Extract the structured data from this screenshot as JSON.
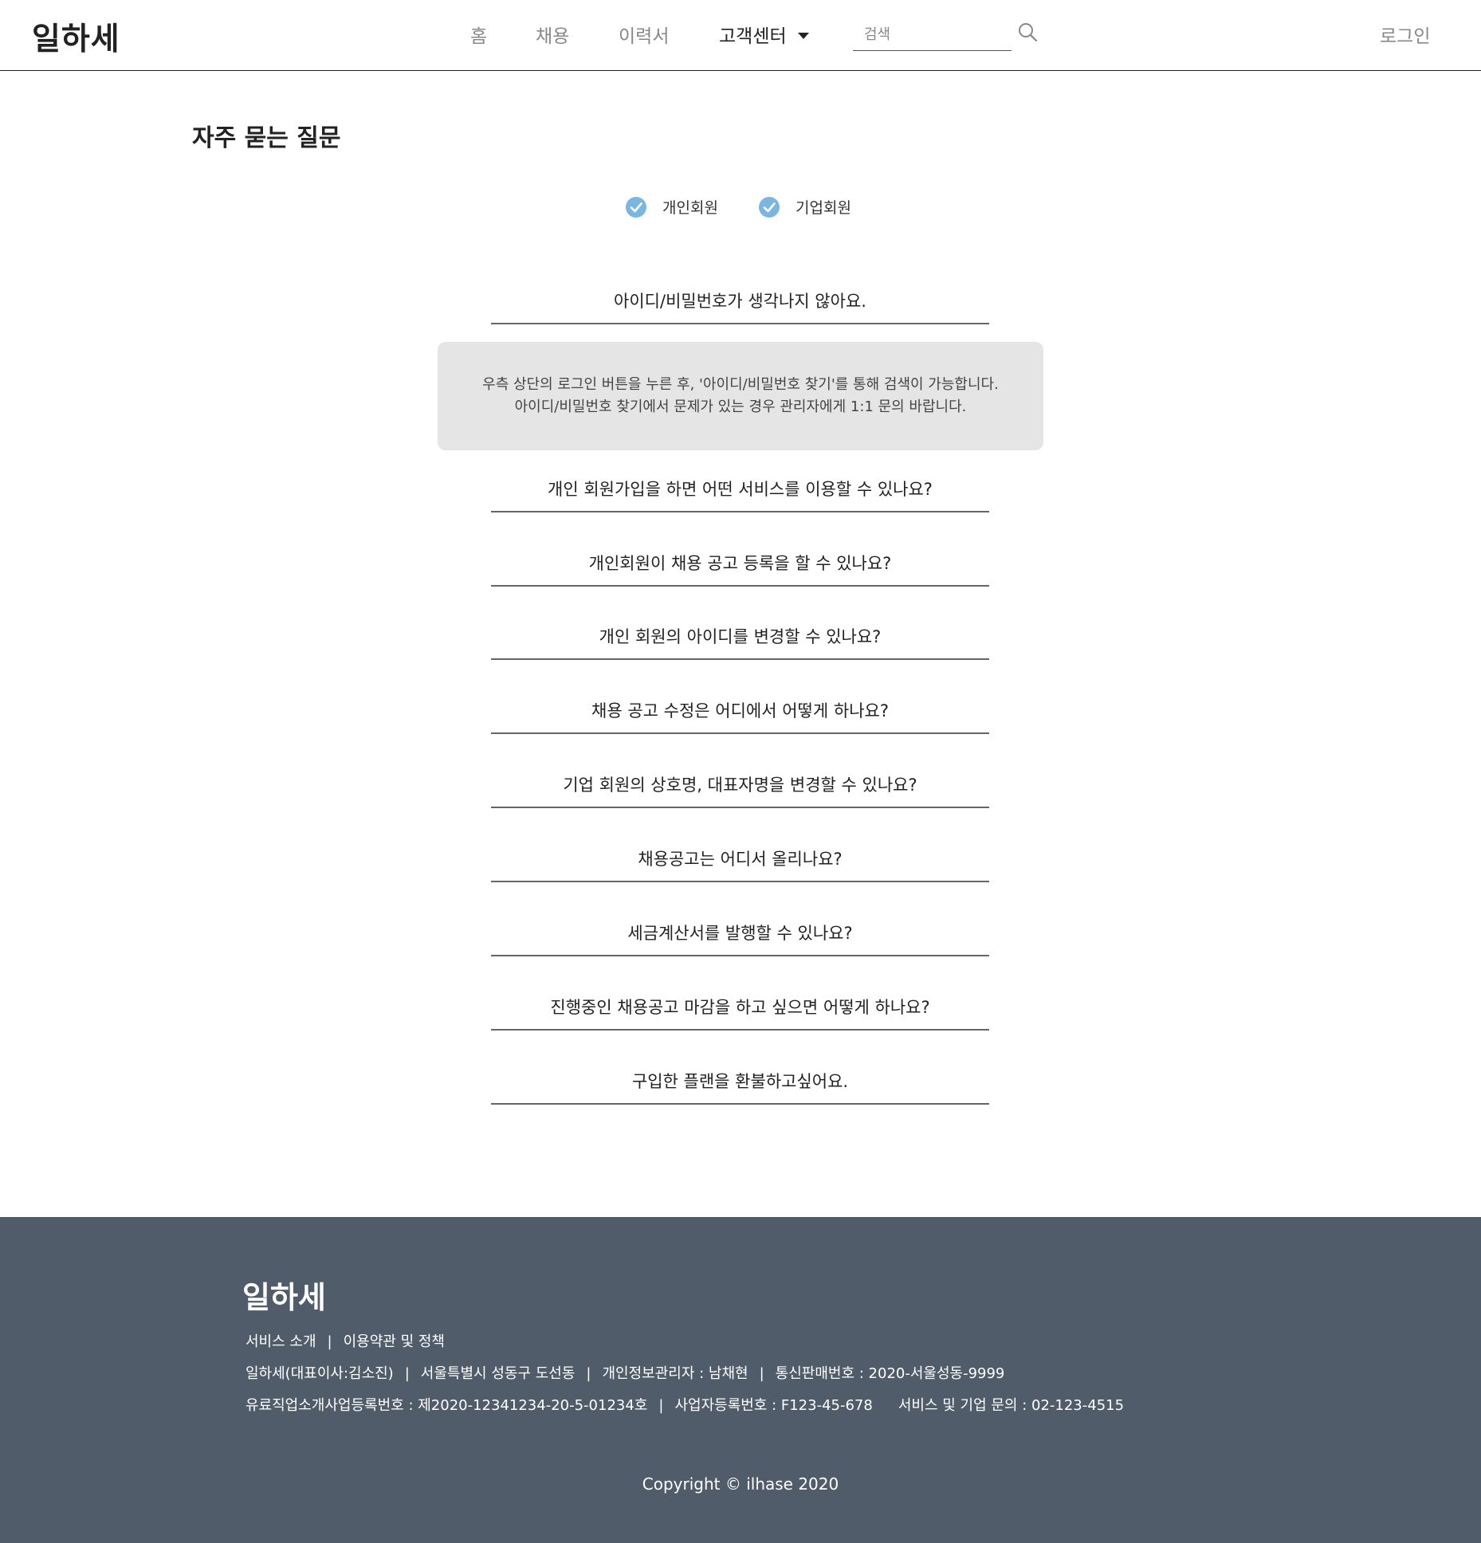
{
  "header": {
    "logo": "일하세",
    "nav": {
      "home": "홈",
      "jobs": "채용",
      "resume": "이력서",
      "support": "고객센터"
    },
    "search_placeholder": "검색",
    "login": "로그인"
  },
  "main": {
    "title": "자주 묻는 질문",
    "filters": [
      {
        "label": "개인회원",
        "checked": true
      },
      {
        "label": "기업회원",
        "checked": true
      }
    ],
    "accent_color": "#7ab6e0",
    "faq": [
      "아이디/비밀번호가 생각나지 않아요.",
      "개인 회원가입을 하면 어떤 서비스를 이용할 수 있나요?",
      "개인회원이 채용 공고 등록을 할 수 있나요?",
      "개인 회원의 아이디를 변경할 수 있나요?",
      "채용 공고 수정은 어디에서 어떻게 하나요?",
      "기업 회원의 상호명, 대표자명을 변경할 수 있나요?",
      "채용공고는 어디서 올리나요?",
      "세금계산서를 발행할 수 있나요?",
      "진행중인 채용공고 마감을 하고 싶으면 어떻게 하나요?",
      "구입한 플랜을 환불하고싶어요."
    ],
    "answer": {
      "line1": "우측 상단의 로그인 버튼을 누른 후, '아이디/비밀번호 찾기'를 통해 검색이 가능합니다.",
      "line2": "아이디/비밀번호 찾기에서 문제가 있는 경우 관리자에게 1:1 문의 바랍니다."
    }
  },
  "footer": {
    "logo": "일하세",
    "links": {
      "about": "서비스 소개",
      "terms": "이용약관 및 정책"
    },
    "info1": {
      "company": "일하세(대표이사:김소진)",
      "address": "서울특별시 성동구 도선동",
      "privacy": "개인정보관리자 : 남채현",
      "ecommerce": "통신판매번호 : 2020-서울성동-9999"
    },
    "info2": {
      "registration": "유료직업소개사업등록번호 : 제2020-12341234-20-5-01234호",
      "business": "사업자등록번호 : F123-45-678",
      "contact": "서비스 및 기업 문의 : 02-123-4515"
    },
    "separator": "|",
    "copyright": "Copyright © ilhase 2020",
    "background": "#505c69"
  }
}
